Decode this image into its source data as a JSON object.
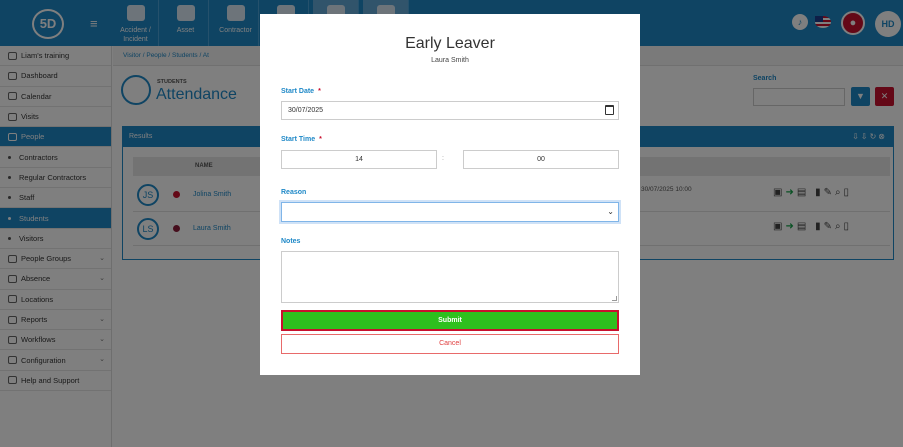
{
  "app": {
    "logo": "5D",
    "topnav": [
      {
        "label": "Accident / Incident"
      },
      {
        "label": "Asset"
      },
      {
        "label": "Contractor"
      },
      {
        "label": ""
      },
      {
        "label": ""
      },
      {
        "label": ""
      }
    ],
    "user_initials": "HD"
  },
  "sidebar": {
    "items": [
      {
        "label": "Liam's training",
        "type": "item",
        "active": false
      },
      {
        "label": "Dashboard",
        "type": "item",
        "active": false
      },
      {
        "label": "Calendar",
        "type": "item",
        "active": false
      },
      {
        "label": "Visits",
        "type": "item",
        "active": false
      },
      {
        "label": "People",
        "type": "item",
        "active": true
      },
      {
        "label": "Contractors",
        "type": "sub",
        "active": false
      },
      {
        "label": "Regular Contractors",
        "type": "sub",
        "active": false
      },
      {
        "label": "Staff",
        "type": "sub",
        "active": false
      },
      {
        "label": "Students",
        "type": "sub",
        "active": true
      },
      {
        "label": "Visitors",
        "type": "sub",
        "active": false
      },
      {
        "label": "People Groups",
        "type": "item",
        "active": false
      },
      {
        "label": "Absence",
        "type": "item",
        "active": false
      },
      {
        "label": "Locations",
        "type": "item",
        "active": false
      },
      {
        "label": "Reports",
        "type": "item",
        "active": false
      },
      {
        "label": "Workflows",
        "type": "item",
        "active": false
      },
      {
        "label": "Configuration",
        "type": "item",
        "active": false
      },
      {
        "label": "Help and Support",
        "type": "item",
        "active": false
      }
    ]
  },
  "breadcrumb": "Visitor / People / Students / At",
  "page": {
    "small_title": "STUDENTS",
    "title": "Attendance",
    "search_label": "Search"
  },
  "results": {
    "title": "Results",
    "column_name": "NAME",
    "rows": [
      {
        "initials": "JS",
        "name": "Jolina Smith",
        "date": "30/07/2025 10:00"
      },
      {
        "initials": "LS",
        "name": "Laura Smith",
        "date": ""
      }
    ]
  },
  "modal": {
    "title": "Early Leaver",
    "subtitle": "Laura Smith",
    "start_date_label": "Start Date",
    "start_date_value": "30/07/2025",
    "start_time_label": "Start Time",
    "hour": "14",
    "minute": "00",
    "time_separator": ":",
    "reason_label": "Reason",
    "reason_value": "",
    "notes_label": "Notes",
    "notes_value": "",
    "submit_label": "Submit",
    "cancel_label": "Cancel",
    "required_mark": "*"
  },
  "colors": {
    "primary": "#1e88c7",
    "danger": "#c8102e",
    "success": "#2ec01e"
  }
}
